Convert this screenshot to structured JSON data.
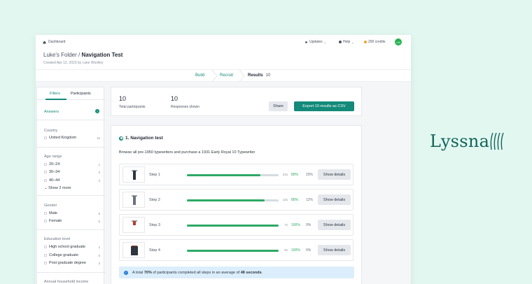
{
  "topbar": {
    "dashboard": "Dashboard",
    "updates": "Updates",
    "help": "Help",
    "credits": "200 credits",
    "avatar": "LW",
    "colors": {
      "credits_dot": "#f5a524",
      "avatar": "#23b14d"
    }
  },
  "header": {
    "folder": "Luke's Folder",
    "separator": " / ",
    "test_name": "Navigation Test",
    "created": "Created Apr 12, 2023 by Luke Woolley"
  },
  "tabs": [
    {
      "label": "Build"
    },
    {
      "label": "Recruit"
    },
    {
      "label": "Results",
      "count": "10"
    }
  ],
  "sidebar": {
    "tabs": [
      "Filters",
      "Participants"
    ],
    "answers": "Answers",
    "sections": [
      {
        "title": "Country",
        "options": [
          {
            "label": "United Kingdom",
            "count": "10"
          }
        ]
      },
      {
        "title": "Age range",
        "options": [
          {
            "label": "20–24",
            "count": "1"
          },
          {
            "label": "30–34",
            "count": "3"
          },
          {
            "label": "40–44",
            "count": "3"
          }
        ],
        "more": "Show 2 more"
      },
      {
        "title": "Gender",
        "options": [
          {
            "label": "Male",
            "count": "5"
          },
          {
            "label": "Female",
            "count": "5"
          }
        ]
      },
      {
        "title": "Education level",
        "options": [
          {
            "label": "High school graduate",
            "count": "2"
          },
          {
            "label": "College graduate",
            "count": "5"
          },
          {
            "label": "Post graduate degree",
            "count": "3"
          }
        ]
      },
      {
        "title": "Annual household income"
      }
    ]
  },
  "stats": {
    "participants_value": "10",
    "participants_label": "Total participants",
    "responses_value": "10",
    "responses_label": "Responses shown",
    "share": "Share",
    "export": "Export 10 results as CSV"
  },
  "section": {
    "title": "1. Navigation test",
    "task": "Browse all pre-1950 typewriters and purchase a 1931 Early Royal 10 Typewriter",
    "steps": [
      {
        "label": "Step 1",
        "time": "24s",
        "completion": "80%",
        "progress": 0.8,
        "dropoff": "20%",
        "button": "Show details"
      },
      {
        "label": "Step 2",
        "time": "13s",
        "completion": "85%",
        "progress": 0.85,
        "dropoff": "12%",
        "button": "Show details"
      },
      {
        "label": "Step 3",
        "time": "7s",
        "completion": "100%",
        "progress": 1.0,
        "dropoff": "0%",
        "button": "Show details"
      },
      {
        "label": "Step 4",
        "time": "5s",
        "completion": "100%",
        "progress": 1.0,
        "dropoff": "0%",
        "button": "Show details"
      }
    ],
    "summary": {
      "prefix": "A total ",
      "percent": "70%",
      "middle": " of participants completed all steps in an average of ",
      "seconds": "48 seconds",
      "suffix": "."
    }
  },
  "brand": {
    "logo": "Lyssna",
    "color": "#10645a"
  }
}
